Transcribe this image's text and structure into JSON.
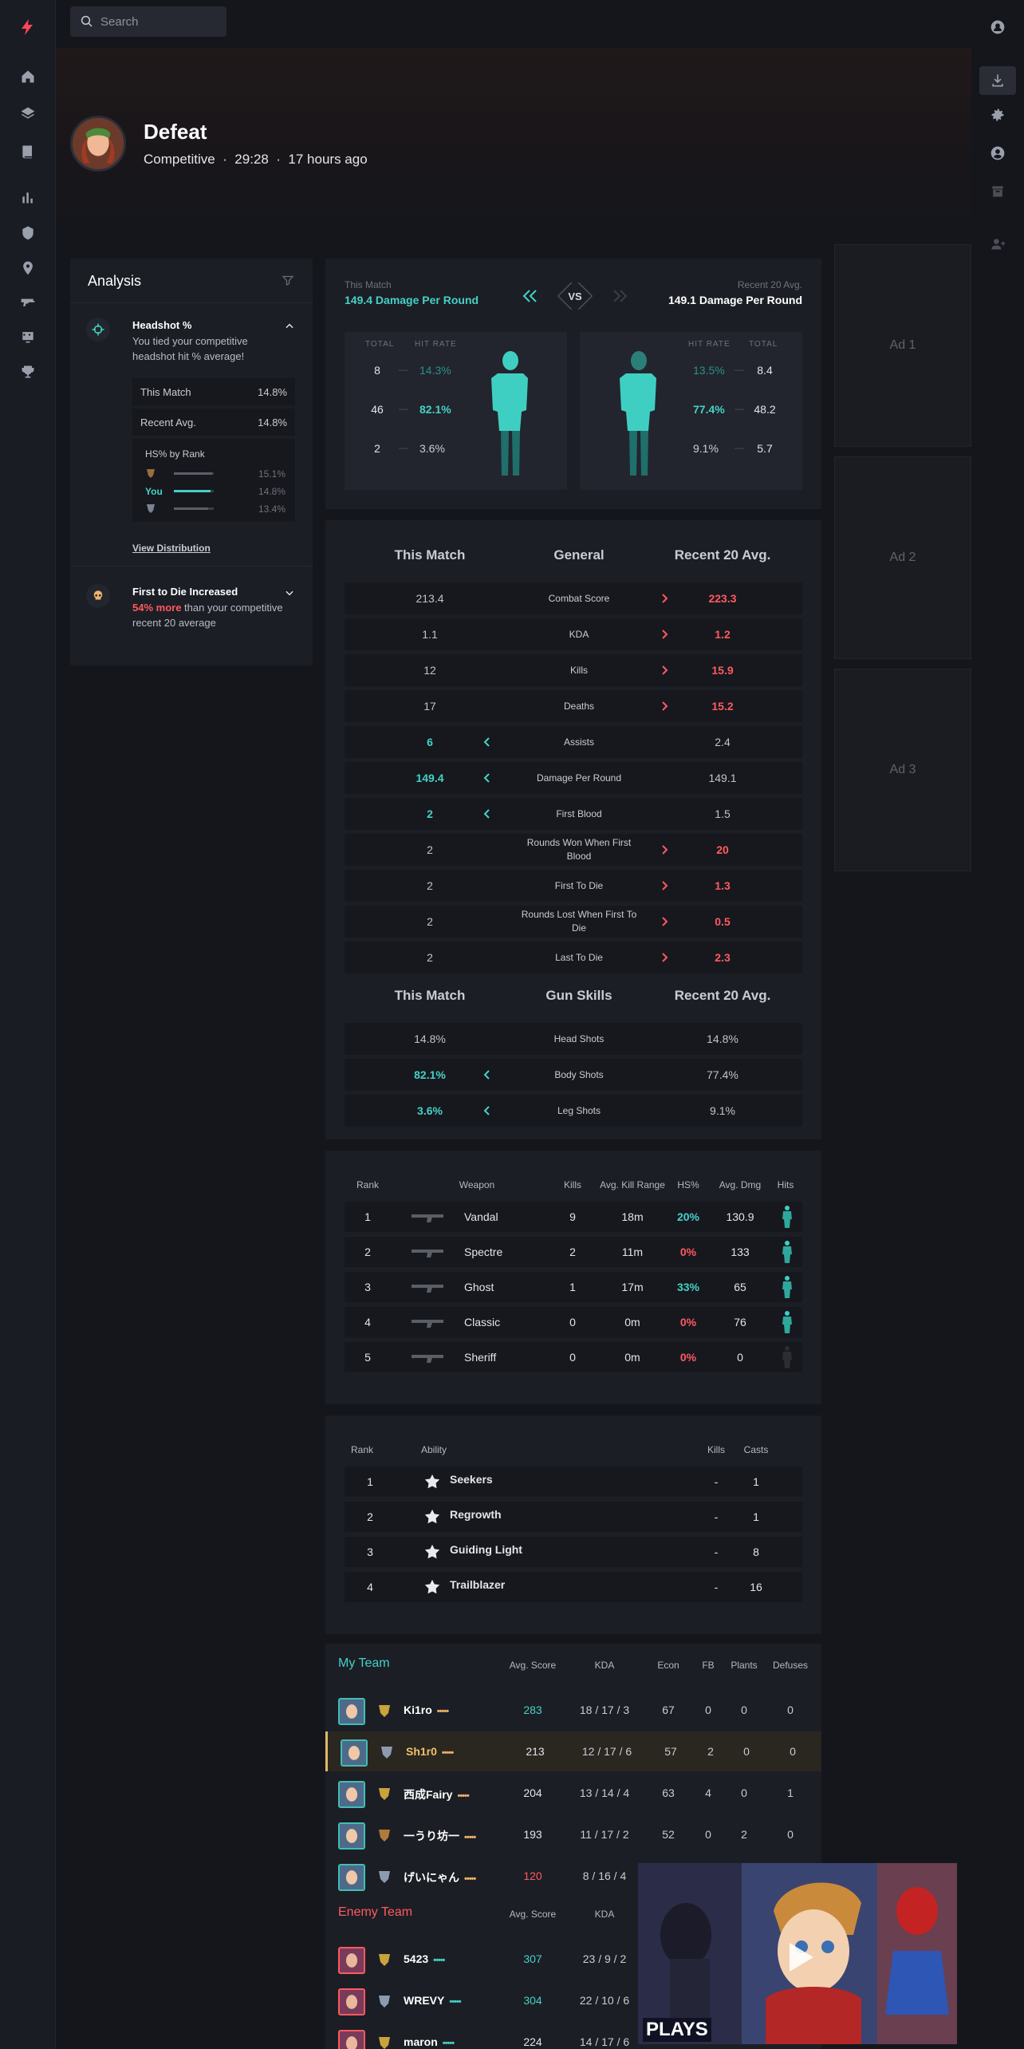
{
  "app": {
    "search_placeholder": "Search"
  },
  "colors": {
    "accent_red": "#ff4655",
    "teal": "#45d1c6",
    "loss_red": "#ff5a5f"
  },
  "match": {
    "result": "Defeat",
    "meta": "Competitive  ·  29:28  ·  17 hours ago"
  },
  "analysis": {
    "title": "Analysis",
    "headshot": {
      "title": "Headshot %",
      "desc": "You tied your competitive headshot hit % average!",
      "this_match_label": "This Match",
      "this_match_value": "14.8%",
      "recent_label": "Recent Avg.",
      "recent_value": "14.8%",
      "rank_title": "HS% by Rank",
      "ranks": [
        {
          "label": "",
          "value": "15.1%",
          "fill": 0.95
        },
        {
          "label": "You",
          "value": "14.8%",
          "fill": 0.92
        },
        {
          "label": "",
          "value": "13.4%",
          "fill": 0.85
        }
      ],
      "view_link": "View Distribution"
    },
    "first_die": {
      "title": "First to Die Increased",
      "highlight": "54% more",
      "desc": " than your competitive recent 20 average"
    }
  },
  "compare": {
    "left_label": "This Match",
    "left_value": "149.4 Damage Per Round",
    "vs": "VS",
    "right_label": "Recent 20 Avg.",
    "right_value": "149.1 Damage Per Round",
    "hdr_total": "TOTAL",
    "hdr_hit": "HIT RATE",
    "left_rows": [
      {
        "total": "8",
        "rate": "14.3%"
      },
      {
        "total": "46",
        "rate": "82.1%"
      },
      {
        "total": "2",
        "rate": "3.6%"
      }
    ],
    "right_rows": [
      {
        "total": "8.4",
        "rate": "13.5%"
      },
      {
        "total": "48.2",
        "rate": "77.4%"
      },
      {
        "total": "5.7",
        "rate": "9.1%"
      }
    ]
  },
  "general": {
    "h_left": "This Match",
    "h_mid": "General",
    "h_right": "Recent 20 Avg.",
    "rows": [
      {
        "label": "Combat Score",
        "left": "213.4",
        "right": "223.3",
        "better": "right"
      },
      {
        "label": "KDA",
        "left": "1.1",
        "right": "1.2",
        "better": "right"
      },
      {
        "label": "Kills",
        "left": "12",
        "right": "15.9",
        "better": "right"
      },
      {
        "label": "Deaths",
        "left": "17",
        "right": "15.2",
        "better": "right"
      },
      {
        "label": "Assists",
        "left": "6",
        "right": "2.4",
        "better": "left"
      },
      {
        "label": "Damage Per Round",
        "left": "149.4",
        "right": "149.1",
        "better": "left"
      },
      {
        "label": "First Blood",
        "left": "2",
        "right": "1.5",
        "better": "left"
      },
      {
        "label": "Rounds Won When First Blood",
        "left": "2",
        "right": "20",
        "better": "right"
      },
      {
        "label": "First To Die",
        "left": "2",
        "right": "1.3",
        "better": "right"
      },
      {
        "label": "Rounds Lost When First To Die",
        "left": "2",
        "right": "0.5",
        "better": "right"
      },
      {
        "label": "Last To Die",
        "left": "2",
        "right": "2.3",
        "better": "right"
      }
    ],
    "g_left": "This Match",
    "g_mid": "Gun Skills",
    "g_right": "Recent 20 Avg.",
    "gun_rows": [
      {
        "label": "Head Shots",
        "left": "14.8%",
        "right": "14.8%",
        "better": "none"
      },
      {
        "label": "Body Shots",
        "left": "82.1%",
        "right": "77.4%",
        "better": "left"
      },
      {
        "label": "Leg Shots",
        "left": "3.6%",
        "right": "9.1%",
        "better": "left"
      }
    ]
  },
  "weapons": {
    "headers": [
      "Rank",
      "Weapon",
      "Kills",
      "Avg. Kill Range",
      "HS%",
      "Avg. Dmg",
      "Hits"
    ],
    "rows": [
      {
        "rank": "1",
        "name": "Vandal",
        "kills": "9",
        "range": "18m",
        "hs": "20%",
        "dmg": "130.9",
        "hs_good": true
      },
      {
        "rank": "2",
        "name": "Spectre",
        "kills": "2",
        "range": "11m",
        "hs": "0%",
        "dmg": "133",
        "hs_good": false
      },
      {
        "rank": "3",
        "name": "Ghost",
        "kills": "1",
        "range": "17m",
        "hs": "33%",
        "dmg": "65",
        "hs_good": true
      },
      {
        "rank": "4",
        "name": "Classic",
        "kills": "0",
        "range": "0m",
        "hs": "0%",
        "dmg": "76",
        "hs_good": false
      },
      {
        "rank": "5",
        "name": "Sheriff",
        "kills": "0",
        "range": "0m",
        "hs": "0%",
        "dmg": "0",
        "hs_good": false
      }
    ]
  },
  "abilities": {
    "headers": [
      "Rank",
      "Ability",
      "Kills",
      "Casts"
    ],
    "rows": [
      {
        "rank": "1",
        "name": "Seekers",
        "kills": "-",
        "casts": "1"
      },
      {
        "rank": "2",
        "name": "Regrowth",
        "kills": "-",
        "casts": "1"
      },
      {
        "rank": "3",
        "name": "Guiding Light",
        "kills": "-",
        "casts": "8"
      },
      {
        "rank": "4",
        "name": "Trailblazer",
        "kills": "-",
        "casts": "16"
      }
    ]
  },
  "team": {
    "my_title": "My Team",
    "enemy_title": "Enemy Team",
    "headers": [
      "Avg. Score",
      "KDA",
      "Econ",
      "FB",
      "Plants",
      "Defuses"
    ],
    "my_rows": [
      {
        "name": "Ki1ro",
        "score": "283",
        "kda": "18 / 17 / 3",
        "econ": "67",
        "fb": "0",
        "plants": "0",
        "defuses": "0",
        "score_color": "#45d1c6",
        "me": false
      },
      {
        "name": "Sh1r0",
        "score": "213",
        "kda": "12 / 17 / 6",
        "econ": "57",
        "fb": "2",
        "plants": "0",
        "defuses": "0",
        "score_color": "#e3e5ea",
        "me": true
      },
      {
        "name": "西成Fairy",
        "score": "204",
        "kda": "13 / 14 / 4",
        "econ": "63",
        "fb": "4",
        "plants": "0",
        "defuses": "1",
        "score_color": "#e3e5ea",
        "me": false
      },
      {
        "name": "一うり坊一",
        "score": "193",
        "kda": "11 / 17 / 2",
        "econ": "52",
        "fb": "0",
        "plants": "2",
        "defuses": "0",
        "score_color": "#e3e5ea",
        "me": false
      },
      {
        "name": "げいにゃん",
        "score": "120",
        "kda": "8 / 16 / 4",
        "econ": "",
        "fb": "",
        "plants": "",
        "defuses": "",
        "score_color": "#ff5a5f",
        "me": false
      }
    ],
    "enemy_headers": [
      "Avg. Score",
      "KDA"
    ],
    "enemy_rows": [
      {
        "name": "5423",
        "score": "307",
        "kda": "23 / 9 / 2",
        "score_color": "#45d1c6"
      },
      {
        "name": "WREVY",
        "score": "304",
        "kda": "22 / 10 / 6",
        "score_color": "#45d1c6"
      },
      {
        "name": "maron",
        "score": "224",
        "kda": "14 / 17 / 6",
        "score_color": "#e3e5ea"
      }
    ]
  },
  "ads": [
    "Ad 1",
    "Ad 2",
    "Ad 3"
  ],
  "video": {
    "brand": "PLAYS"
  }
}
